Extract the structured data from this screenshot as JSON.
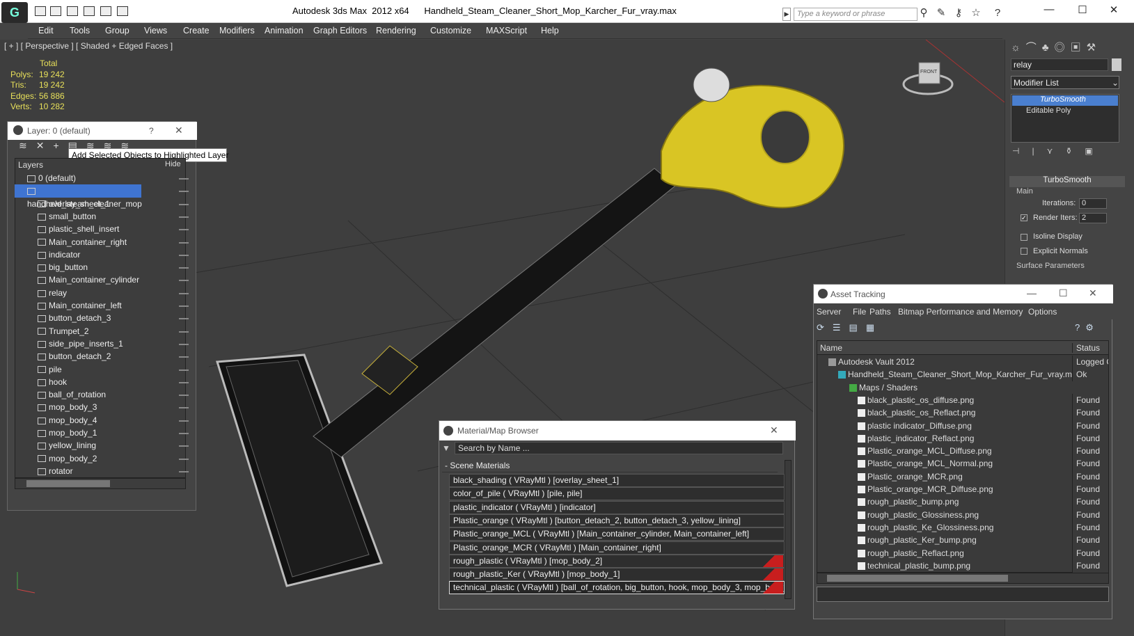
{
  "window": {
    "title": "Autodesk 3ds Max  2012 x64      Handheld_Steam_Cleaner_Short_Mop_Karcher_Fur_vray.max",
    "search_placeholder": "Type a keyword or phrase"
  },
  "menu": [
    "Edit",
    "Tools",
    "Group",
    "Views",
    "Create",
    "Modifiers",
    "Animation",
    "Graph Editors",
    "Rendering",
    "Customize",
    "MAXScript",
    "Help"
  ],
  "viewport": {
    "label": "[ + ] [ Perspective ] [ Shaded + Edged Faces ]",
    "stats_header": "Total",
    "stats": [
      {
        "k": "Polys:",
        "v": "19 242"
      },
      {
        "k": "Tris:",
        "v": "19 242"
      },
      {
        "k": "Edges:",
        "v": "56 886"
      },
      {
        "k": "Verts:",
        "v": "10 282"
      }
    ],
    "viewcube": "FRONT"
  },
  "layer_window": {
    "title": "Layer: 0 (default)",
    "help": "?",
    "tooltip": "Add Selected Objects to Highlighted Layer",
    "col_layers": "Layers",
    "col_hide": "Hide",
    "items": [
      "0 (default)",
      "handheld_steam_cleaner_mop",
      "overlay_sheet_1",
      "small_button",
      "plastic_shell_insert",
      "Main_container_right",
      "indicator",
      "big_button",
      "Main_container_cylinder",
      "relay",
      "Main_container_left",
      "button_detach_3",
      "Trumpet_2",
      "side_pipe_inserts_1",
      "button_detach_2",
      "pile",
      "hook",
      "ball_of_rotation",
      "mop_body_3",
      "mop_body_4",
      "mop_body_1",
      "yellow_lining",
      "mop_body_2",
      "rotator"
    ]
  },
  "modify_panel": {
    "name_field": "relay",
    "modifier_list": "Modifier List",
    "stack": [
      "TurboSmooth",
      "Editable Poly"
    ],
    "rollout": "TurboSmooth",
    "group_main": "Main",
    "iterations_label": "Iterations:",
    "iterations_value": "0",
    "render_iters_label": "Render Iters:",
    "render_iters_value": "2",
    "isoline": "Isoline Display",
    "explicit": "Explicit Normals",
    "surface": "Surface Parameters"
  },
  "asset_tracking": {
    "title": "Asset Tracking",
    "menu": [
      "Server",
      "File",
      "Paths",
      "Bitmap Performance and Memory",
      "Options"
    ],
    "col_name": "Name",
    "col_status": "Status",
    "rows": [
      {
        "name": "Autodesk Vault 2012",
        "status": "Logged C"
      },
      {
        "name": "Handheld_Steam_Cleaner_Short_Mop_Karcher_Fur_vray.max",
        "status": "Ok"
      },
      {
        "name": "Maps / Shaders",
        "status": ""
      },
      {
        "name": "black_plastic_os_diffuse.png",
        "status": "Found"
      },
      {
        "name": "black_plastic_os_Reflact.png",
        "status": "Found"
      },
      {
        "name": "plastic indicator_Diffuse.png",
        "status": "Found"
      },
      {
        "name": "plastic_indicator_Reflact.png",
        "status": "Found"
      },
      {
        "name": "Plastic_orange_MCL_Diffuse.png",
        "status": "Found"
      },
      {
        "name": "Plastic_orange_MCL_Normal.png",
        "status": "Found"
      },
      {
        "name": "Plastic_orange_MCR.png",
        "status": "Found"
      },
      {
        "name": "Plastic_orange_MCR_Diffuse.png",
        "status": "Found"
      },
      {
        "name": "rough_plastic_bump.png",
        "status": "Found"
      },
      {
        "name": "rough_plastic_Glossiness.png",
        "status": "Found"
      },
      {
        "name": "rough_plastic_Ke_Glossiness.png",
        "status": "Found"
      },
      {
        "name": "rough_plastic_Ker_bump.png",
        "status": "Found"
      },
      {
        "name": "rough_plastic_Reflact.png",
        "status": "Found"
      },
      {
        "name": "technical_plastic_bump.png",
        "status": "Found"
      }
    ]
  },
  "material_browser": {
    "title": "Material/Map Browser",
    "search": "Search by Name ...",
    "section": "- Scene Materials",
    "rows": [
      "black_shading  ( VRayMtl ) [overlay_sheet_1]",
      "color_of_pile  ( VRayMtl ) [pile, pile]",
      "plastic_indicator  ( VRayMtl ) [indicator]",
      "Plastic_orange  ( VRayMtl ) [button_detach_2, button_detach_3, yellow_lining]",
      "Plastic_orange_MCL  ( VRayMtl ) [Main_container_cylinder, Main_container_left]",
      "Plastic_orange_MCR  ( VRayMtl ) [Main_container_right]",
      "rough_plastic  ( VRayMtl ) [mop_body_2]",
      "rough_plastic_Ker  ( VRayMtl ) [mop_body_1]",
      "technical_plastic ( VRayMtl ) [ball_of_rotation, big_button, hook, mop_body_3, mop_body_..."
    ]
  }
}
